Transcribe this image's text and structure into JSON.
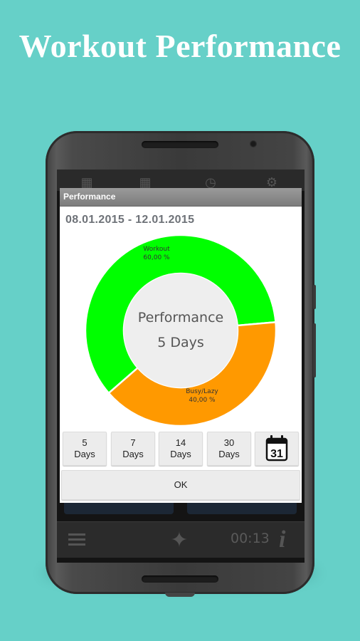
{
  "headline": "Workout Performance",
  "dialog": {
    "title": "Performance",
    "date_range": "08.01.2015 - 12.01.2015",
    "center_line1": "Performance",
    "center_line2": "5 Days",
    "buttons": [
      {
        "line1": "5",
        "line2": "Days"
      },
      {
        "line1": "7",
        "line2": "Days"
      },
      {
        "line1": "14",
        "line2": "Days"
      },
      {
        "line1": "30",
        "line2": "Days"
      }
    ],
    "calendar_day": "31",
    "ok_label": "OK"
  },
  "chart_data": {
    "type": "pie",
    "categories": [
      "Workout",
      "Busy/Lazy"
    ],
    "values": [
      60.0,
      40.0
    ],
    "labels": [
      {
        "name": "Workout",
        "value": "60,00 %"
      },
      {
        "name": "Busy/Lazy",
        "value": "40,00 %"
      }
    ],
    "colors": [
      "#00ff00",
      "#ff9900"
    ]
  },
  "background_app": {
    "timer": "00:13"
  },
  "icons": {
    "calendar": "calendar-icon",
    "menu": "menu-icon",
    "figure": "person-figure-icon",
    "info": "info-icon"
  }
}
